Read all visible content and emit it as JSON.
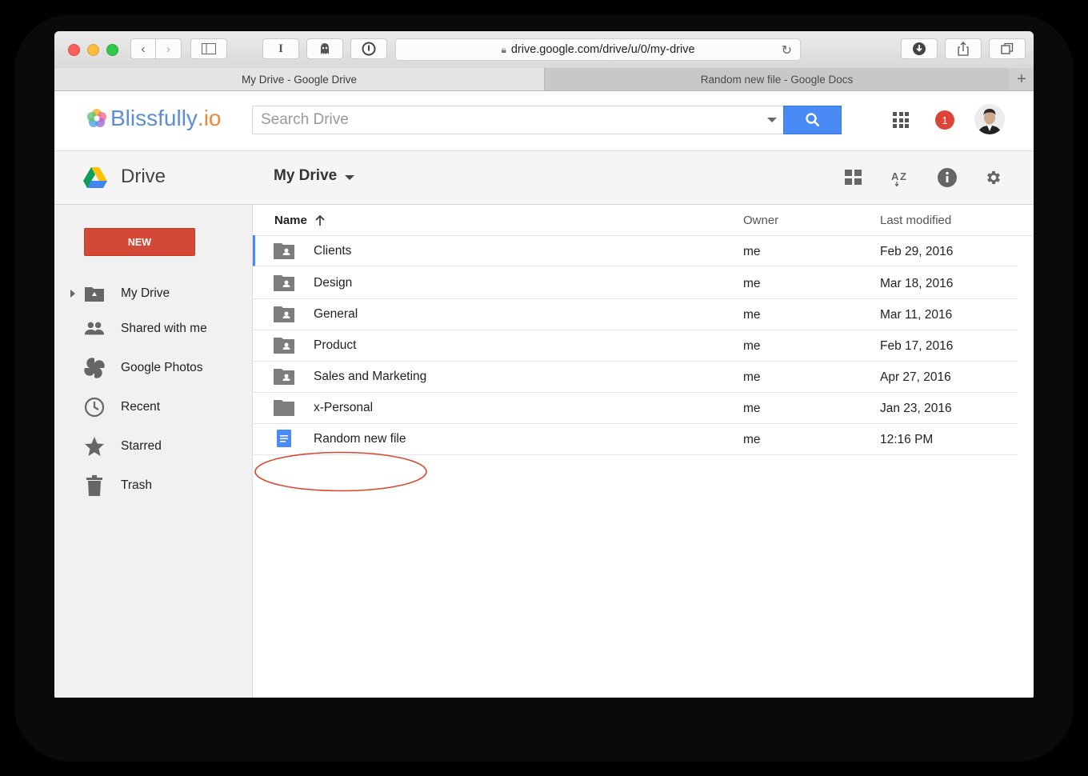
{
  "browser": {
    "url": "drive.google.com/drive/u/0/my-drive",
    "tabs": [
      {
        "label": "My Drive - Google Drive",
        "active": true
      },
      {
        "label": "Random new file - Google Docs",
        "active": false
      }
    ],
    "toolbar_icons": [
      "back-icon",
      "forward-icon",
      "sidebar-icon",
      "reader-icon",
      "ghostery-icon",
      "password-icon",
      "download-icon",
      "share-icon",
      "tabs-icon"
    ]
  },
  "header": {
    "brand_main": "Blissfully",
    "brand_suffix": ".io",
    "search_placeholder": "Search Drive",
    "notification_count": "1"
  },
  "drivebar": {
    "title": "Drive",
    "breadcrumb": "My Drive"
  },
  "sidebar": {
    "new_label": "NEW",
    "items": [
      {
        "label": "My Drive",
        "icon": "my-drive-icon"
      },
      {
        "label": "Shared with me",
        "icon": "shared-icon"
      },
      {
        "label": "Google Photos",
        "icon": "photos-icon"
      },
      {
        "label": "Recent",
        "icon": "clock-icon"
      },
      {
        "label": "Starred",
        "icon": "star-icon"
      },
      {
        "label": "Trash",
        "icon": "trash-icon"
      }
    ]
  },
  "list": {
    "columns": {
      "name": "Name",
      "owner": "Owner",
      "modified": "Last modified"
    },
    "rows": [
      {
        "name": "Clients",
        "owner": "me",
        "modified": "Feb 29, 2016",
        "type": "shared-folder"
      },
      {
        "name": "Design",
        "owner": "me",
        "modified": "Mar 18, 2016",
        "type": "shared-folder"
      },
      {
        "name": "General",
        "owner": "me",
        "modified": "Mar 11, 2016",
        "type": "shared-folder"
      },
      {
        "name": "Product",
        "owner": "me",
        "modified": "Feb 17, 2016",
        "type": "shared-folder"
      },
      {
        "name": "Sales and Marketing",
        "owner": "me",
        "modified": "Apr 27, 2016",
        "type": "shared-folder"
      },
      {
        "name": "x-Personal",
        "owner": "me",
        "modified": "Jan 23, 2016",
        "type": "folder"
      },
      {
        "name": "Random new file",
        "owner": "me",
        "modified": "12:16 PM",
        "type": "doc"
      }
    ]
  },
  "colors": {
    "accent_blue": "#4a8af4",
    "new_button": "#d34836",
    "annotation": "#d9482f"
  }
}
